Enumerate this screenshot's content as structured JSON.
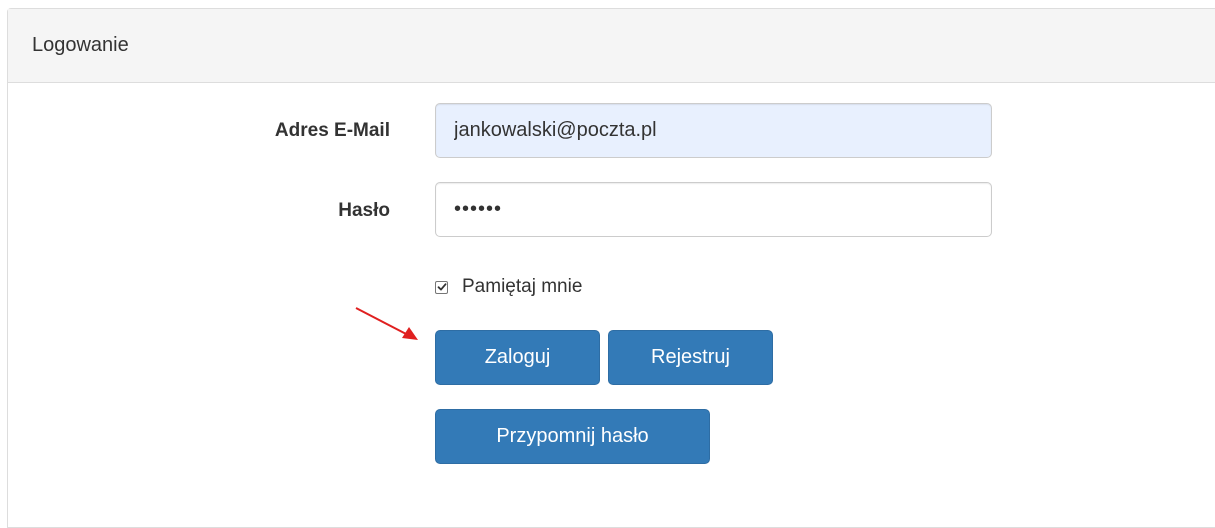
{
  "panel": {
    "title": "Logowanie"
  },
  "form": {
    "email_label": "Adres E-Mail",
    "email_value": "jankowalski@poczta.pl",
    "password_label": "Hasło",
    "password_value": "••••••",
    "remember_label": "Pamiętaj mnie",
    "remember_checked": true
  },
  "buttons": {
    "login": "Zaloguj",
    "register": "Rejestruj",
    "remind": "Przypomnij hasło"
  },
  "colors": {
    "primary": "#337ab7",
    "annotation_arrow": "#e02020",
    "autofill_bg": "#e8f0fe"
  },
  "icons": {
    "annotation": "red-arrow-icon",
    "check": "check-icon"
  }
}
